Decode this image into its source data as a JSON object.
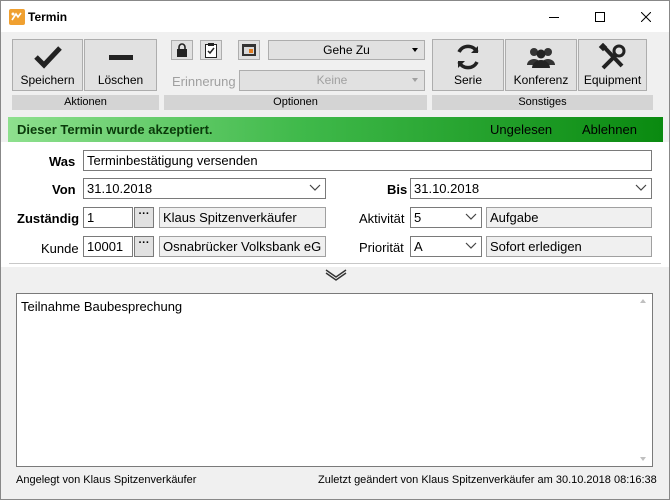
{
  "window": {
    "title": "Termin"
  },
  "ribbon": {
    "aktionen": {
      "label": "Aktionen",
      "save_label": "Speichern",
      "delete_label": "Löschen"
    },
    "optionen": {
      "label": "Optionen",
      "visibility_value": "Gehe Zu",
      "reminder_label": "Erinnerung",
      "reminder_value": "Keine"
    },
    "sonstiges": {
      "label": "Sonstiges",
      "serie_label": "Serie",
      "konferenz_label": "Konferenz",
      "equipment_label": "Equipment"
    }
  },
  "status": {
    "message": "Dieser Termin wurde akzeptiert.",
    "unread_link": "Ungelesen",
    "decline_link": "Ablehnen",
    "colors": {
      "start": "#8ee08e",
      "end": "#0a8a10"
    }
  },
  "form": {
    "was_label": "Was",
    "was_value": "Terminbestätigung versenden",
    "von_label": "Von",
    "von_value": "31.10.2018",
    "bis_label": "Bis",
    "bis_value": "31.10.2018",
    "zustaendig_label": "Zuständig",
    "zustaendig_id": "1",
    "zustaendig_name": "Klaus Spitzenverkäufer",
    "aktivitaet_label": "Aktivität",
    "aktivitaet_value": "5",
    "aktivitaet_name": "Aufgabe",
    "kunde_label": "Kunde",
    "kunde_id": "10001",
    "kunde_name": "Osnabrücker Volksbank eG",
    "prioritaet_label": "Priorität",
    "prioritaet_value": "A",
    "prioritaet_name": "Sofort erledigen",
    "dots_label": "···"
  },
  "notes": {
    "text": "Teilnahme Baubesprechung"
  },
  "footer": {
    "created": "Angelegt von Klaus Spitzenverkäufer",
    "modified": "Zuletzt geändert von Klaus Spitzenverkäufer am 30.10.2018 08:16:38"
  }
}
